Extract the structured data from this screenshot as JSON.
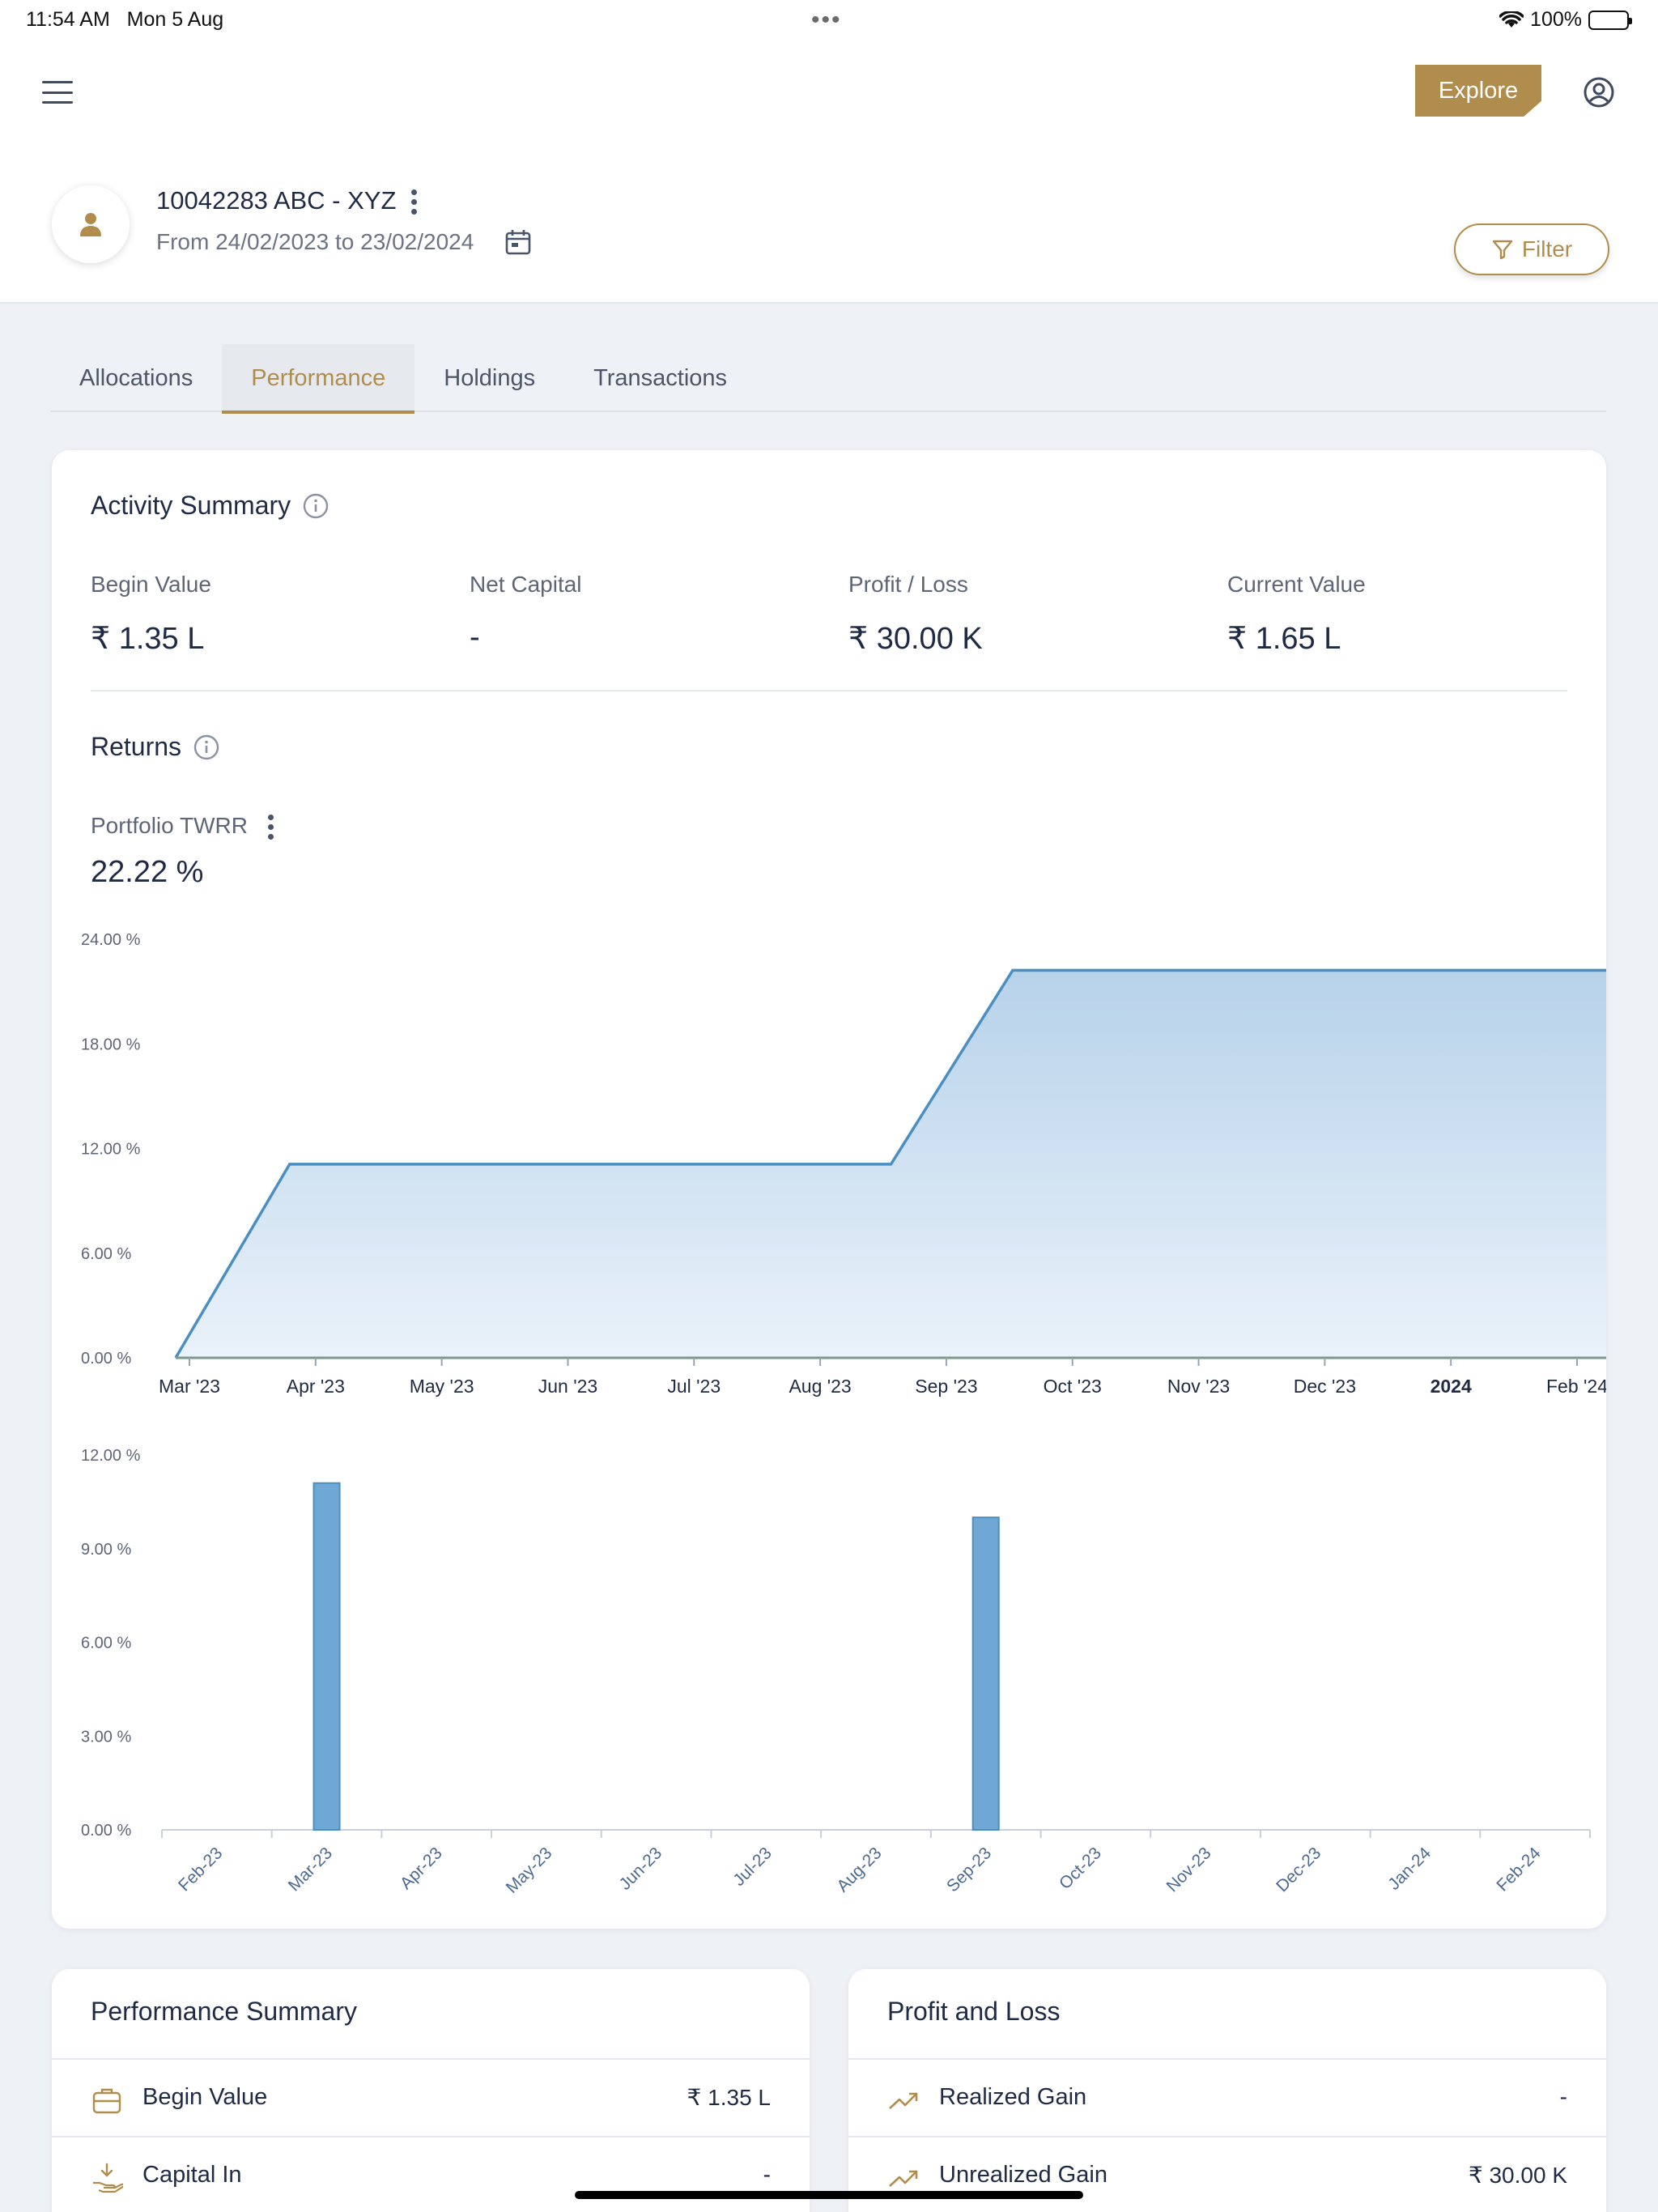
{
  "status_bar": {
    "time": "11:54 AM",
    "date": "Mon 5 Aug",
    "battery": "100%"
  },
  "header": {
    "explore_label": "Explore"
  },
  "account": {
    "title": "10042283 ABC - XYZ",
    "date_range": "From 24/02/2023 to 23/02/2024"
  },
  "filter": {
    "label": "Filter"
  },
  "tabs": [
    {
      "label": "Allocations"
    },
    {
      "label": "Performance",
      "active": true
    },
    {
      "label": "Holdings"
    },
    {
      "label": "Transactions"
    }
  ],
  "activity_summary": {
    "title": "Activity Summary",
    "stats": [
      {
        "label": "Begin Value",
        "value": "₹ 1.35 L"
      },
      {
        "label": "Net Capital",
        "value": "-"
      },
      {
        "label": "Profit / Loss",
        "value": "₹ 30.00 K"
      },
      {
        "label": "Current Value",
        "value": "₹ 1.65 L"
      }
    ]
  },
  "returns": {
    "title": "Returns",
    "metric_label": "Portfolio TWRR",
    "metric_value": "22.22 %"
  },
  "colors": {
    "accent": "#b08d4c",
    "area_stroke": "#4a8ec2",
    "bar_fill": "#6fa8d4",
    "bar_stroke": "#4a8ec2"
  },
  "chart_data": [
    {
      "type": "area",
      "y_ticks": [
        "24.00 %",
        "18.00 %",
        "12.00 %",
        "6.00 %",
        "0.00 %"
      ],
      "ylim": [
        0,
        24
      ],
      "x_tick_labels": [
        "Mar '23",
        "Apr '23",
        "May '23",
        "Jun '23",
        "Jul '23",
        "Aug '23",
        "Sep '23",
        "Oct '23",
        "Nov '23",
        "Dec '23",
        "2024",
        "Feb '24"
      ],
      "x": [
        "2023-02-24",
        "2023-03-25",
        "2023-08-25",
        "2023-09-25",
        "2024-02-23"
      ],
      "values": [
        0,
        11.1,
        11.1,
        22.22,
        22.22
      ],
      "grid": false
    },
    {
      "type": "bar",
      "y_ticks": [
        "12.00 %",
        "9.00 %",
        "6.00 %",
        "3.00 %",
        "0.00 %"
      ],
      "ylim": [
        0,
        12
      ],
      "categories": [
        "Feb-23",
        "Mar-23",
        "Apr-23",
        "May-23",
        "Jun-23",
        "Jul-23",
        "Aug-23",
        "Sep-23",
        "Oct-23",
        "Nov-23",
        "Dec-23",
        "Jan-24",
        "Feb-24"
      ],
      "values": [
        0,
        11.1,
        0,
        0,
        0,
        0,
        0,
        10.0,
        0,
        0,
        0,
        0,
        0
      ],
      "grid": false
    }
  ],
  "performance_summary": {
    "title": "Performance Summary",
    "rows": [
      {
        "label": "Begin Value",
        "value": "₹ 1.35 L",
        "icon": "briefcase-icon"
      },
      {
        "label": "Capital In",
        "value": "-",
        "icon": "hand-money-in-icon"
      }
    ]
  },
  "profit_loss": {
    "title": "Profit and Loss",
    "rows": [
      {
        "label": "Realized Gain",
        "value": "-",
        "icon": "trending-up-icon"
      },
      {
        "label": "Unrealized Gain",
        "value": "₹ 30.00 K",
        "icon": "trending-up-icon"
      }
    ]
  }
}
